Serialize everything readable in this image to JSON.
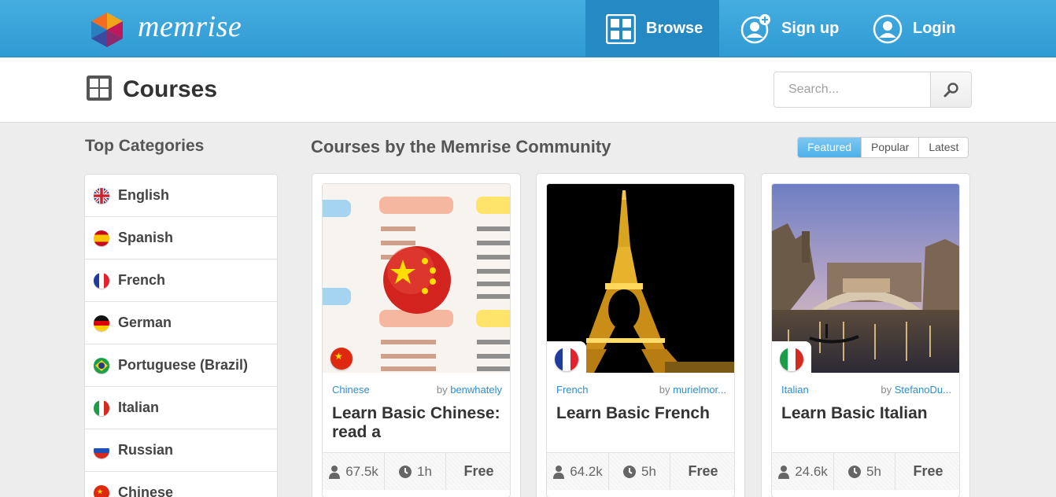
{
  "brand": {
    "name": "memrise"
  },
  "nav": {
    "browse": "Browse",
    "signup": "Sign up",
    "login": "Login"
  },
  "header": {
    "title": "Courses",
    "search_placeholder": "Search..."
  },
  "sidebar": {
    "title": "Top Categories",
    "items": [
      {
        "label": "English",
        "flag": "uk-flag-icon"
      },
      {
        "label": "Spanish",
        "flag": "spain-flag-icon"
      },
      {
        "label": "French",
        "flag": "france-flag-icon"
      },
      {
        "label": "German",
        "flag": "germany-flag-icon"
      },
      {
        "label": "Portuguese (Brazil)",
        "flag": "brazil-flag-icon"
      },
      {
        "label": "Italian",
        "flag": "italy-flag-icon"
      },
      {
        "label": "Russian",
        "flag": "russia-flag-icon"
      },
      {
        "label": "Chinese",
        "flag": "china-flag-icon"
      }
    ]
  },
  "main": {
    "title": "Courses by the Memrise Community",
    "filters": [
      "Featured",
      "Popular",
      "Latest"
    ],
    "active_filter": "Featured",
    "courses": [
      {
        "category": "Chinese",
        "by": "by",
        "author": "benwhately",
        "title": "Learn Basic Chinese: read a",
        "learners": "67.5k",
        "time": "1h",
        "price": "Free"
      },
      {
        "category": "French",
        "by": "by",
        "author": "murielmor...",
        "title": "Learn Basic French",
        "learners": "64.2k",
        "time": "5h",
        "price": "Free"
      },
      {
        "category": "Italian",
        "by": "by",
        "author": "StefanoDu...",
        "title": "Learn Basic Italian",
        "learners": "24.6k",
        "time": "5h",
        "price": "Free"
      }
    ]
  },
  "colors": {
    "topbar": "#3aa6dc",
    "browse_active": "#2589c3",
    "link": "#2e8fd0",
    "filter_active": "#5bb8ec"
  }
}
